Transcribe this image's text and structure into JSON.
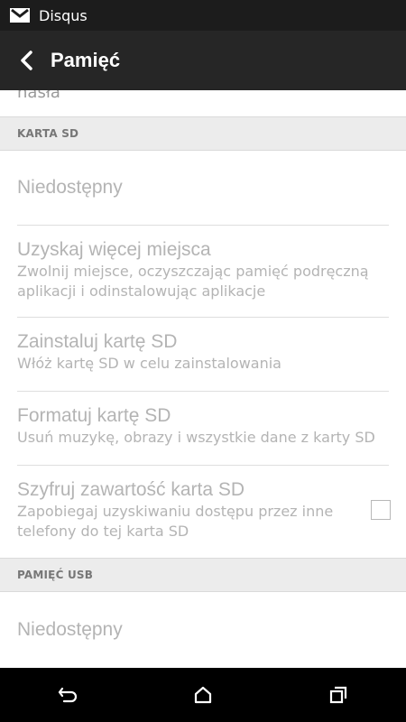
{
  "status": {
    "app_name": "Disqus",
    "notification_icon": "gmail-icon"
  },
  "header": {
    "title": "Pamięć",
    "back_icon": "back-arrow-icon"
  },
  "partial_text": "hasła",
  "sections": [
    {
      "header": "KARTA SD",
      "items": [
        {
          "title": "Niedostępny",
          "subtitle": ""
        },
        {
          "title": "Uzyskaj więcej miejsca",
          "subtitle": "Zwolnij miejsce, oczyszczając pamięć podręczną aplikacji i odinstalowując aplikacje"
        },
        {
          "title": "Zainstaluj kartę SD",
          "subtitle": "Włóż kartę SD w celu zainstalowania"
        },
        {
          "title": "Formatuj kartę SD",
          "subtitle": "Usuń muzykę, obrazy i wszystkie dane z karty SD"
        },
        {
          "title": "Szyfruj zawartość karta SD",
          "subtitle": "Zapobiegaj uzyskiwaniu dostępu przez inne telefony do tej karta SD",
          "checkbox_checked": false
        }
      ]
    },
    {
      "header": "PAMIĘĆ USB",
      "items": [
        {
          "title": "Niedostępny",
          "subtitle": ""
        }
      ]
    }
  ],
  "navbar": {
    "back_icon": "nav-back-icon",
    "home_icon": "home-icon",
    "recents_icon": "recents-icon"
  },
  "colors": {
    "status_bar": "#1c1c1c",
    "action_bar": "#262626",
    "disabled_text": "#b4b4b4",
    "section_bg": "#ececec"
  }
}
